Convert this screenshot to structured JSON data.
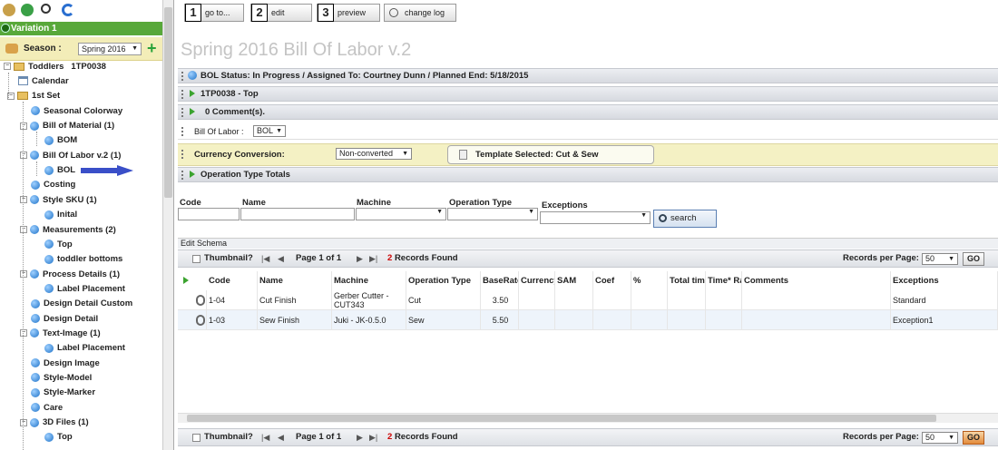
{
  "sidebar": {
    "variation_label": "Variation 1",
    "season_label": "Season :",
    "season_value": "Spring 2016",
    "root_label": "Toddlers",
    "root_code": "1TP0038",
    "tree": [
      {
        "label": "Calendar",
        "level": 1,
        "icon": "calendar-icon"
      },
      {
        "label": "1st Set",
        "level": 1,
        "icon": "folder-icon",
        "expander": "-"
      },
      {
        "label": "Seasonal Colorway",
        "level": 2,
        "icon": "ball-icon"
      },
      {
        "label": "Bill of Material (1)",
        "level": 2,
        "icon": "ball-icon",
        "expander": "-"
      },
      {
        "label": "BOM",
        "level": 3,
        "icon": "ball-icon"
      },
      {
        "label": "Bill Of Labor v.2 (1)",
        "level": 2,
        "icon": "ball-icon",
        "expander": "-"
      },
      {
        "label": "BOL",
        "level": 3,
        "icon": "ball-icon"
      },
      {
        "label": "Costing",
        "level": 2,
        "icon": "ball-icon"
      },
      {
        "label": "Style SKU (1)",
        "level": 2,
        "icon": "ball-icon",
        "expander": "-"
      },
      {
        "label": "Inital",
        "level": 3,
        "icon": "ball-icon"
      },
      {
        "label": "Measurements (2)",
        "level": 2,
        "icon": "ball-icon",
        "expander": "-"
      },
      {
        "label": "Top",
        "level": 3,
        "icon": "ball-icon"
      },
      {
        "label": "toddler bottoms",
        "level": 3,
        "icon": "ball-icon"
      },
      {
        "label": "Process Details (1)",
        "level": 2,
        "icon": "ball-icon",
        "expander": "-"
      },
      {
        "label": "Label Placement",
        "level": 3,
        "icon": "ball-icon"
      },
      {
        "label": "Design Detail Custom",
        "level": 2,
        "icon": "ball-icon"
      },
      {
        "label": "Design Detail",
        "level": 2,
        "icon": "ball-icon"
      },
      {
        "label": "Text-Image (1)",
        "level": 2,
        "icon": "ball-icon",
        "expander": "-"
      },
      {
        "label": "Label Placement",
        "level": 3,
        "icon": "ball-icon"
      },
      {
        "label": "Design Image",
        "level": 2,
        "icon": "ball-icon"
      },
      {
        "label": "Style-Model",
        "level": 2,
        "icon": "ball-icon"
      },
      {
        "label": "Style-Marker",
        "level": 2,
        "icon": "ball-icon"
      },
      {
        "label": "Care",
        "level": 2,
        "icon": "ball-icon"
      },
      {
        "label": "3D Files (1)",
        "level": 2,
        "icon": "ball-icon",
        "expander": "-"
      },
      {
        "label": "Top",
        "level": 3,
        "icon": "ball-icon"
      }
    ]
  },
  "toolbar": {
    "goto": {
      "num": "1",
      "label": "go to..."
    },
    "edit": {
      "num": "2",
      "label": "edit"
    },
    "preview": {
      "num": "3",
      "label": "preview"
    },
    "changelog": "change log"
  },
  "page_title": "Spring 2016 Bill Of Labor v.2",
  "status_bar": "BOL  Status: In Progress / Assigned To: Courtney Dunn / Planned End: 5/18/2015",
  "section_top": "1TP0038 - Top",
  "comments": "0 Comment(s).",
  "bol_label": "Bill Of Labor  :",
  "bol_value": "BOL",
  "currency_label": "Currency Conversion:",
  "currency_value": "Non-converted",
  "template_selected": "Template Selected: Cut & Sew",
  "operation_totals": "Operation Type Totals",
  "filters": {
    "code": "Code",
    "name": "Name",
    "machine": "Machine",
    "operation_type": "Operation Type",
    "exceptions": "Exceptions",
    "search": "search"
  },
  "edit_schema": "Edit Schema",
  "pager": {
    "thumbnail": "Thumbnail?",
    "page_text": "Page 1 of 1",
    "records_count": "2",
    "records_label": "Records Found",
    "rpp_label": "Records per Page:",
    "rpp_value": "50",
    "go": "GO"
  },
  "grid": {
    "headers": [
      "Code",
      "Name",
      "Machine",
      "Operation Type",
      "BaseRate",
      "Currency",
      "SAM",
      "Coef",
      "%",
      "Total time",
      "Time* Rate",
      "Comments",
      "Exceptions"
    ],
    "rows": [
      {
        "code": "1-04",
        "name": "Cut Finish",
        "machine": "Gerber Cutter - CUT343",
        "operation_type": "Cut",
        "baserate": "3.50",
        "exceptions": "Standard"
      },
      {
        "code": "1-03",
        "name": "Sew Finish",
        "machine": "Juki - JK-0.5.0",
        "operation_type": "Sew",
        "baserate": "5.50",
        "exceptions": "Exception1"
      }
    ]
  },
  "colors": {
    "variation_green": "#58a83a",
    "season_bg": "#f3edb8",
    "records_red": "#cc0000",
    "arrow_blue": "#3a4fc8"
  }
}
